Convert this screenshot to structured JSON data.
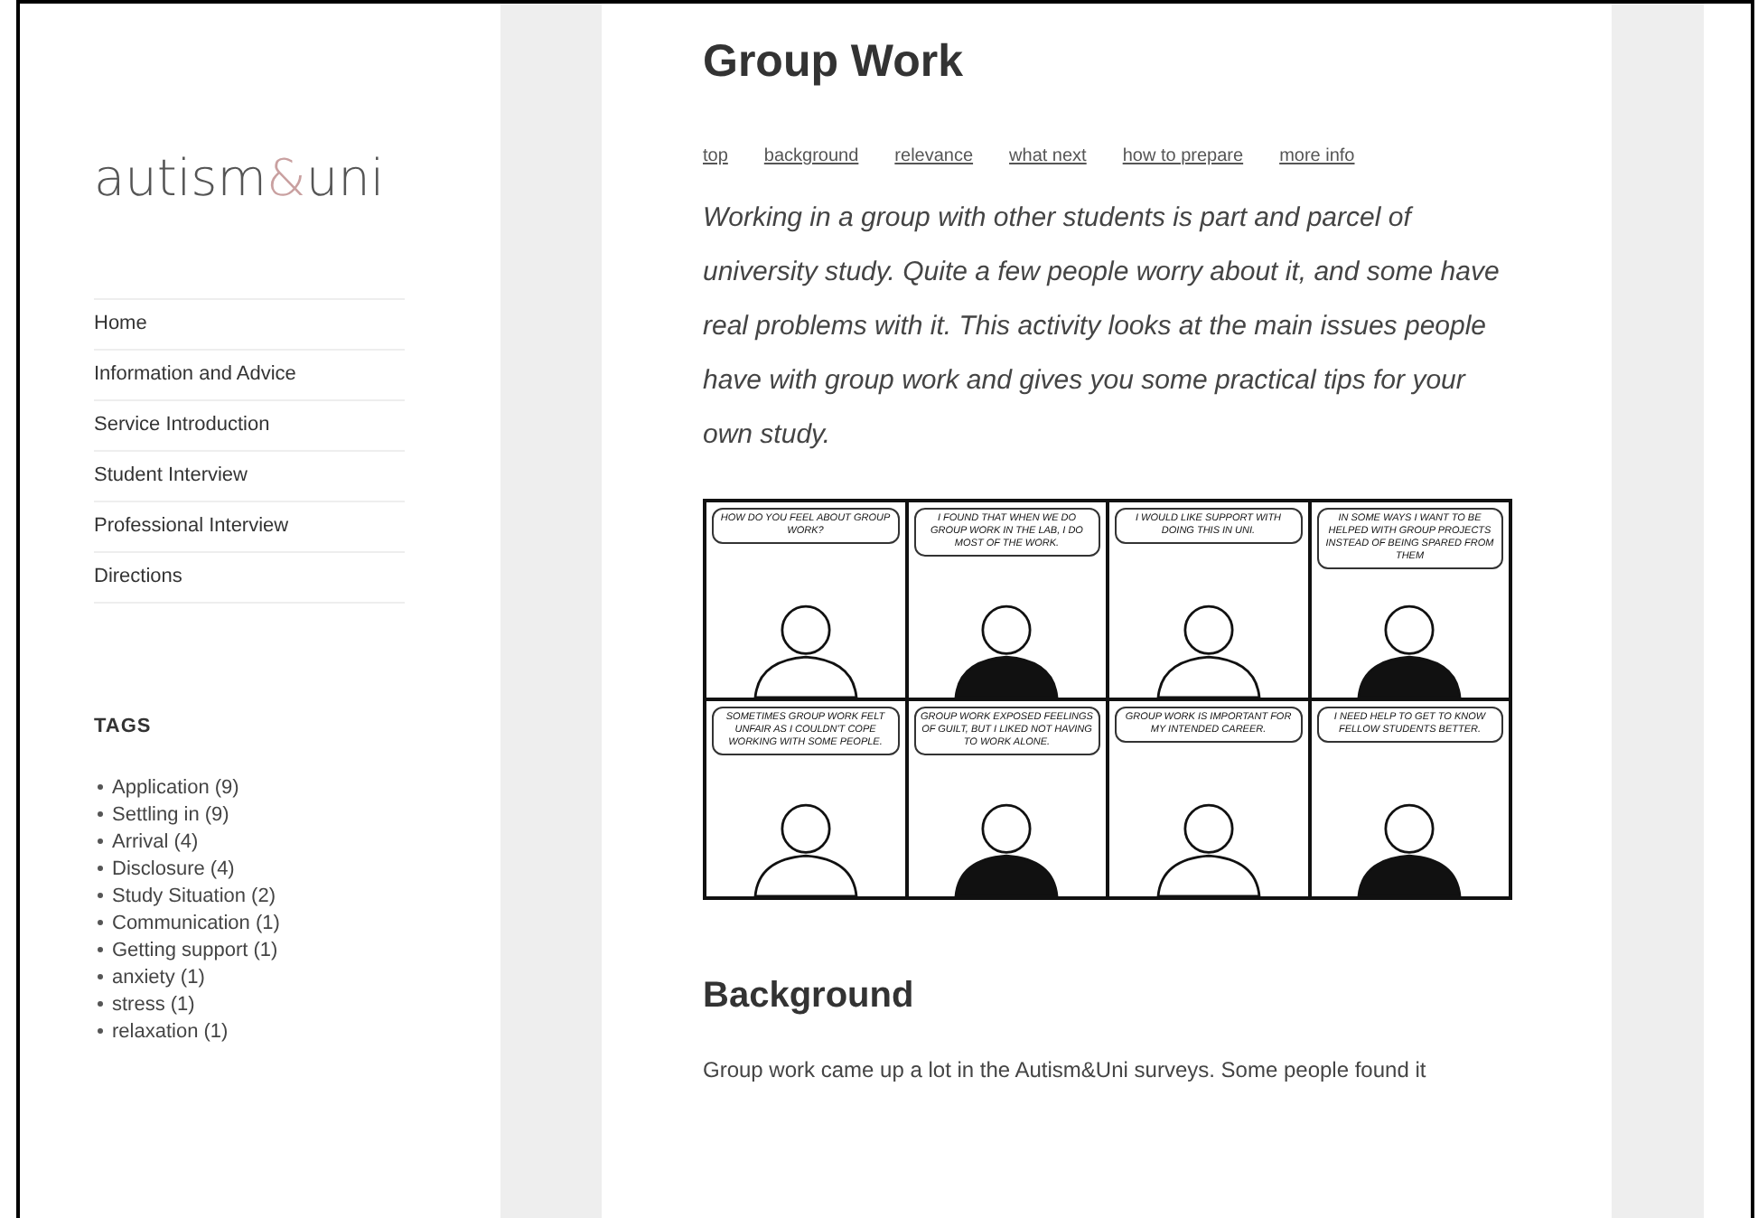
{
  "sidebar": {
    "logo": {
      "before": "autism",
      "accent": "&",
      "after": "uni"
    },
    "menu": [
      {
        "label": "Home"
      },
      {
        "label": "Information and Advice"
      },
      {
        "label": "Service Introduction"
      },
      {
        "label": "Student Interview"
      },
      {
        "label": "Professional Interview"
      },
      {
        "label": "Directions"
      }
    ],
    "tags": {
      "heading": "TAGS",
      "items": [
        {
          "label": "Application (9)"
        },
        {
          "label": "Settling in (9)"
        },
        {
          "label": "Arrival (4)"
        },
        {
          "label": "Disclosure (4)"
        },
        {
          "label": "Study Situation (2)"
        },
        {
          "label": "Communication (1)"
        },
        {
          "label": "Getting support (1)"
        },
        {
          "label": "anxiety (1)"
        },
        {
          "label": "stress (1)"
        },
        {
          "label": "relaxation (1)"
        }
      ]
    }
  },
  "article": {
    "title": "Group Work",
    "anchors": [
      {
        "label": "top"
      },
      {
        "label": "background"
      },
      {
        "label": "relevance"
      },
      {
        "label": "what next"
      },
      {
        "label": "how to prepare"
      },
      {
        "label": "more info"
      }
    ],
    "intro": "Working in a group with other students is part and parcel of university study. Quite a few people worry about it, and some have real problems with it. This activity looks at the main issues people have with group work and gives you some practical tips for your own study.",
    "comic": [
      {
        "speech": "HOW DO YOU FEEL ABOUT GROUP WORK?"
      },
      {
        "speech": "I FOUND THAT WHEN WE DO GROUP WORK IN THE LAB, I DO MOST OF THE WORK."
      },
      {
        "speech": "I WOULD LIKE SUPPORT WITH DOING THIS IN UNI."
      },
      {
        "speech": "IN SOME WAYS I WANT TO BE HELPED WITH GROUP PROJECTS INSTEAD OF BEING SPARED FROM THEM"
      },
      {
        "speech": "SOMETIMES GROUP WORK FELT UNFAIR AS I COULDN'T COPE WORKING WITH SOME PEOPLE."
      },
      {
        "speech": "GROUP WORK EXPOSED FEELINGS OF GUILT, BUT I LIKED NOT HAVING TO WORK ALONE."
      },
      {
        "speech": "GROUP WORK IS IMPORTANT FOR MY INTENDED CAREER."
      },
      {
        "speech": "I NEED HELP TO GET TO KNOW FELLOW STUDENTS BETTER."
      }
    ],
    "section_heading": "Background",
    "section_text": "Group work came up a lot in the Autism&Uni surveys. Some people found it"
  }
}
